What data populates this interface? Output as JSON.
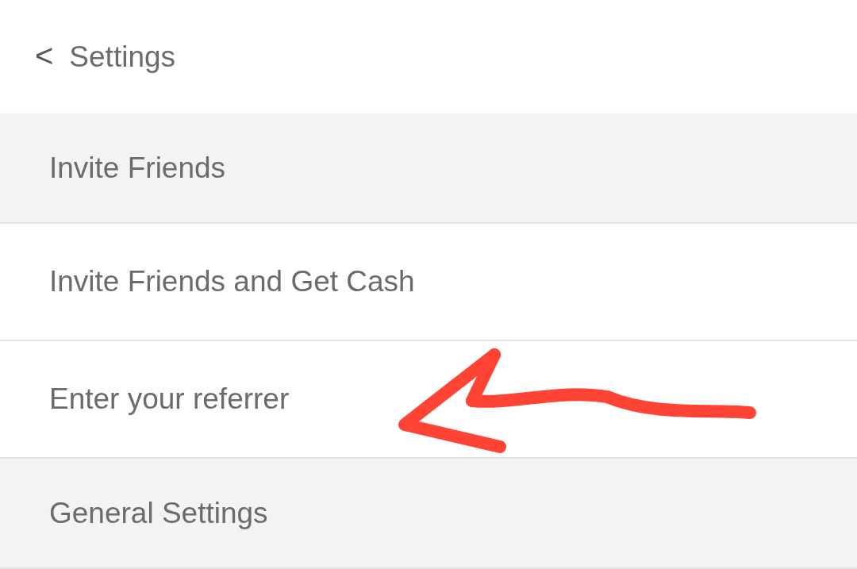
{
  "header": {
    "back_icon": "<",
    "title": "Settings"
  },
  "rows": [
    {
      "kind": "section",
      "label": "Invite Friends"
    },
    {
      "kind": "item",
      "label": "Invite Friends and Get Cash"
    },
    {
      "kind": "item",
      "label": "Enter your referrer",
      "annotated": true
    },
    {
      "kind": "section",
      "label": "General Settings"
    }
  ]
}
